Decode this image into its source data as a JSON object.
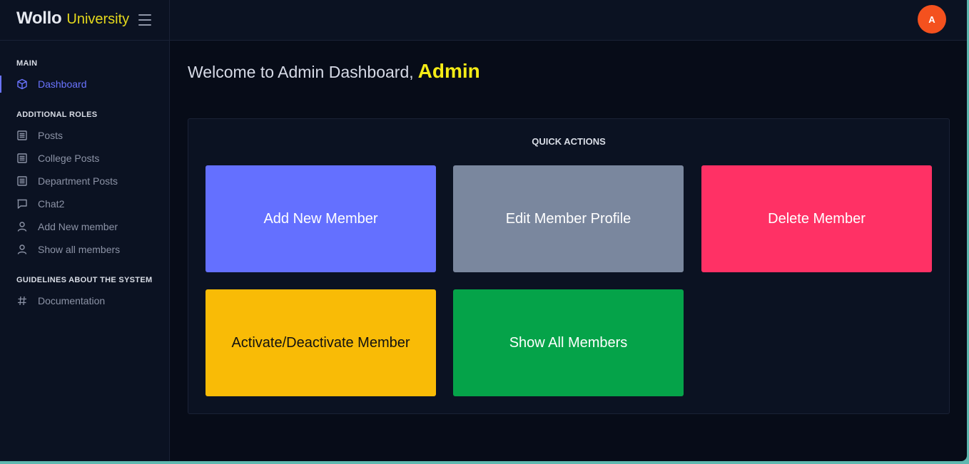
{
  "brand": {
    "name": "Wollo",
    "subtitle": "University"
  },
  "user": {
    "avatar_initial": "A"
  },
  "sidebar": {
    "sections": [
      {
        "title": "MAIN"
      },
      {
        "title": "ADDITIONAL ROLES"
      },
      {
        "title": "GUIDELINES ABOUT THE SYSTEM"
      }
    ],
    "items": [
      {
        "label": "Dashboard",
        "icon": "cube-icon",
        "active": true
      },
      {
        "label": "Posts",
        "icon": "list-icon"
      },
      {
        "label": "College Posts",
        "icon": "list-icon"
      },
      {
        "label": "Department Posts",
        "icon": "list-icon"
      },
      {
        "label": "Chat2",
        "icon": "chat-icon"
      },
      {
        "label": "Add New member",
        "icon": "user-icon"
      },
      {
        "label": "Show all members",
        "icon": "user-icon"
      },
      {
        "label": "Documentation",
        "icon": "hash-icon"
      }
    ]
  },
  "main": {
    "welcome_text": "Welcome to Admin Dashboard,",
    "welcome_name": "Admin",
    "quick_actions": {
      "title": "QUICK ACTIONS",
      "buttons": [
        {
          "label": "Add New Member",
          "color": "#6470ff",
          "text_color": "#ffffff"
        },
        {
          "label": "Edit Member Profile",
          "color": "#7a879e",
          "text_color": "#ffffff"
        },
        {
          "label": "Delete Member",
          "color": "#ff3165",
          "text_color": "#ffffff"
        },
        {
          "label": "Activate/Deactivate Member",
          "color": "#f9bb06",
          "text_color": "#111111"
        },
        {
          "label": "Show All Members",
          "color": "#05a349",
          "text_color": "#ffffff"
        }
      ]
    }
  },
  "colors": {
    "accent": "#6a74ff",
    "brand_accent": "#e5d91c",
    "welcome_name": "#f5ec16",
    "avatar": "#f4511e",
    "background": "#070c18",
    "panel": "#0b1222"
  }
}
